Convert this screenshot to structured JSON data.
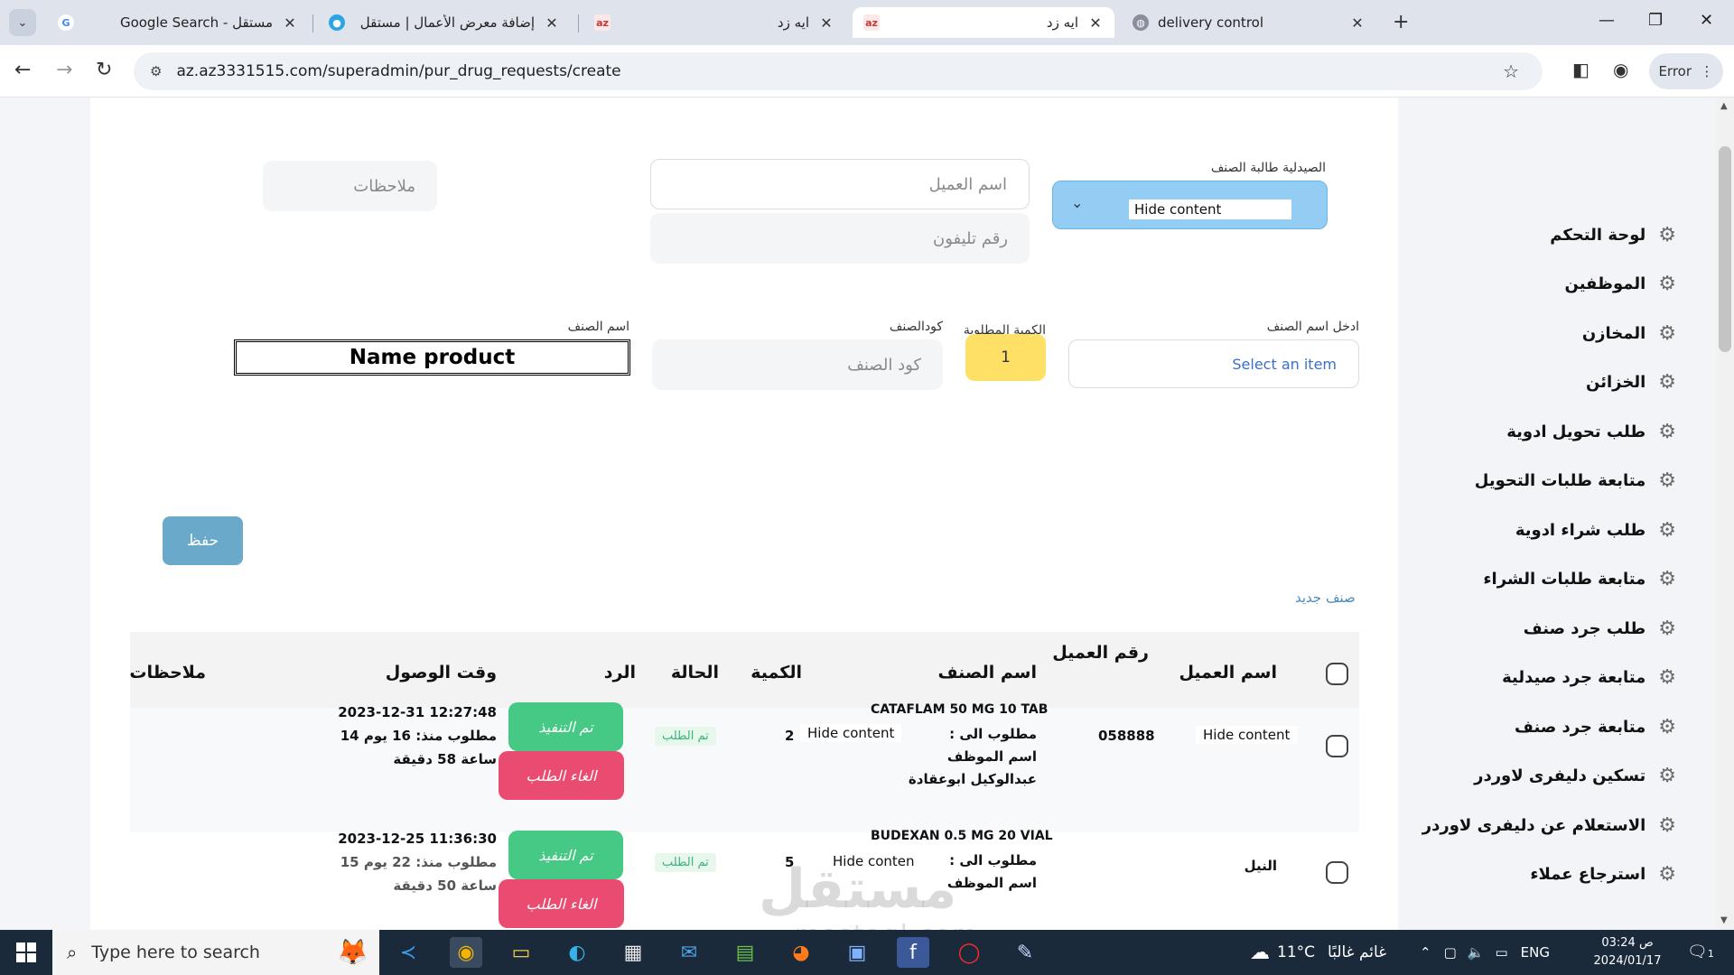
{
  "browser": {
    "tabs": [
      {
        "title": "Google Search - مستقل",
        "favicon": "google-icon"
      },
      {
        "title": "إضافة معرض الأعمال | مستقل",
        "favicon": "mostaql-icon"
      },
      {
        "title": "ايه زد",
        "favicon": "az-icon"
      },
      {
        "title": "ايه زد",
        "favicon": "az-icon",
        "active": true
      },
      {
        "title": "delivery control",
        "favicon": "globe-icon"
      }
    ],
    "url": "az.az3331515.com/superadmin/pur_drug_requests/create",
    "error_label": "Error"
  },
  "form": {
    "pharmacy_label": "الصيدلية طالبة الصنف",
    "pharmacy_value": "Hide content",
    "customer_name_placeholder": "اسم العميل",
    "phone_placeholder": "رقم تليفون",
    "notes_placeholder": "ملاحظات",
    "item_name_input_label": "ادخل اسم الصنف",
    "item_select_placeholder": "Select an item",
    "qty_label": "الكمية المطلوبة",
    "qty_value": "1",
    "code_label": "كودالصنف",
    "code_placeholder": "كود الصنف",
    "item_name_label": "اسم الصنف",
    "item_name_value": "Name product",
    "save_label": "حفظ",
    "new_item_link": "صنف جديد"
  },
  "sidebar": {
    "items": [
      "لوحة التحكم",
      "الموظفين",
      "المخازن",
      "الخزائن",
      "طلب تحويل ادوية",
      "متابعة طلبات التحويل",
      "طلب شراء ادوية",
      "متابعة طلبات الشراء",
      "طلب جرد صنف",
      "متابعة جرد صيدلية",
      "متابعة جرد صنف",
      "تسكين دليفرى لاوردر",
      "الاستعلام عن دليفرى لاوردر",
      "استرجاع عملاء"
    ]
  },
  "table": {
    "headers": {
      "customer_name": "اسم العميل",
      "customer_number": "رقم العميل",
      "item_name": "اسم الصنف",
      "quantity": "الكمية",
      "status": "الحالة",
      "reply": "الرد",
      "arrival_time": "وقت الوصول",
      "notes": "ملاحظات"
    },
    "rows": [
      {
        "customer": "Hide content",
        "customer_number": "058888",
        "item": "CATAFLAM 50 MG 10 TAB",
        "required_to": "مطلوب الى :",
        "required_to_value": "Hide content",
        "employee_label": "اسم الموظف",
        "employee_name": "عبدالوكيل ابوعقادة",
        "quantity": "2",
        "status": "تم الطلب",
        "done_label": "تم التنفيذ",
        "cancel_label": "الغاء الطلب",
        "arrival": "2023-12-31 12:27:48",
        "elapsed_1": "مطلوب منذ: 16 يوم 14",
        "elapsed_2": "ساعة 58 دقيقة"
      },
      {
        "customer": "النيل",
        "customer_number": "",
        "item": "BUDEXAN 0.5 MG 20 VIAL",
        "required_to": "مطلوب الى :",
        "required_to_value": "Hide conten",
        "employee_label": "اسم الموظف",
        "employee_name": "",
        "quantity": "5",
        "status": "تم الطلب",
        "done_label": "تم التنفيذ",
        "cancel_label": "الغاء الطلب",
        "arrival": "2023-12-25 11:36:30",
        "elapsed_1": "مطلوب منذ: 22 يوم 15",
        "elapsed_2": "ساعة 50 دقيقة"
      }
    ]
  },
  "watermark": {
    "ar": "مستقل",
    "en": "mostaql.com"
  },
  "taskbar": {
    "search_placeholder": "Type here to search",
    "weather_temp": "11°C",
    "weather_text": "غائم غالبًا",
    "lang": "ENG",
    "time_period": "ص",
    "time": "03:24",
    "date": "2024/01/17",
    "notifications": "1"
  }
}
